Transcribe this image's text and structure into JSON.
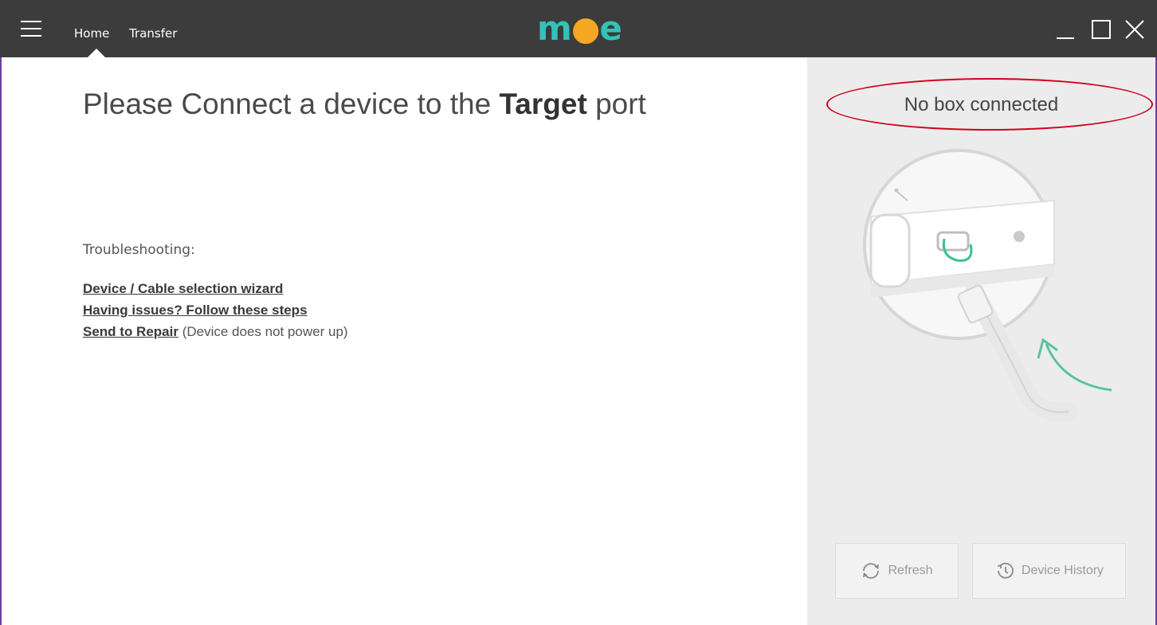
{
  "app": {
    "logo_text": "mce",
    "accent": "#33c2b8",
    "logo_dot": "#f5a623"
  },
  "nav": {
    "tabs": [
      "Home",
      "Transfer"
    ],
    "active": "Home"
  },
  "main": {
    "title_prefix": "Please Connect a device to the ",
    "title_bold": "Target",
    "title_suffix": " port",
    "troubleshooting_label": "Troubleshooting:",
    "links": {
      "wizard": "Device / Cable selection wizard",
      "issues": "Having issues? Follow these steps",
      "repair": "Send to Repair",
      "repair_note": " (Device does not power up)"
    }
  },
  "panel": {
    "status": "No box connected",
    "refresh_label": "Refresh",
    "history_label": "Device History"
  },
  "icons": [
    "menu-icon",
    "minimize-icon",
    "maximize-icon",
    "close-icon",
    "refresh-icon",
    "history-icon",
    "usb-icon"
  ]
}
